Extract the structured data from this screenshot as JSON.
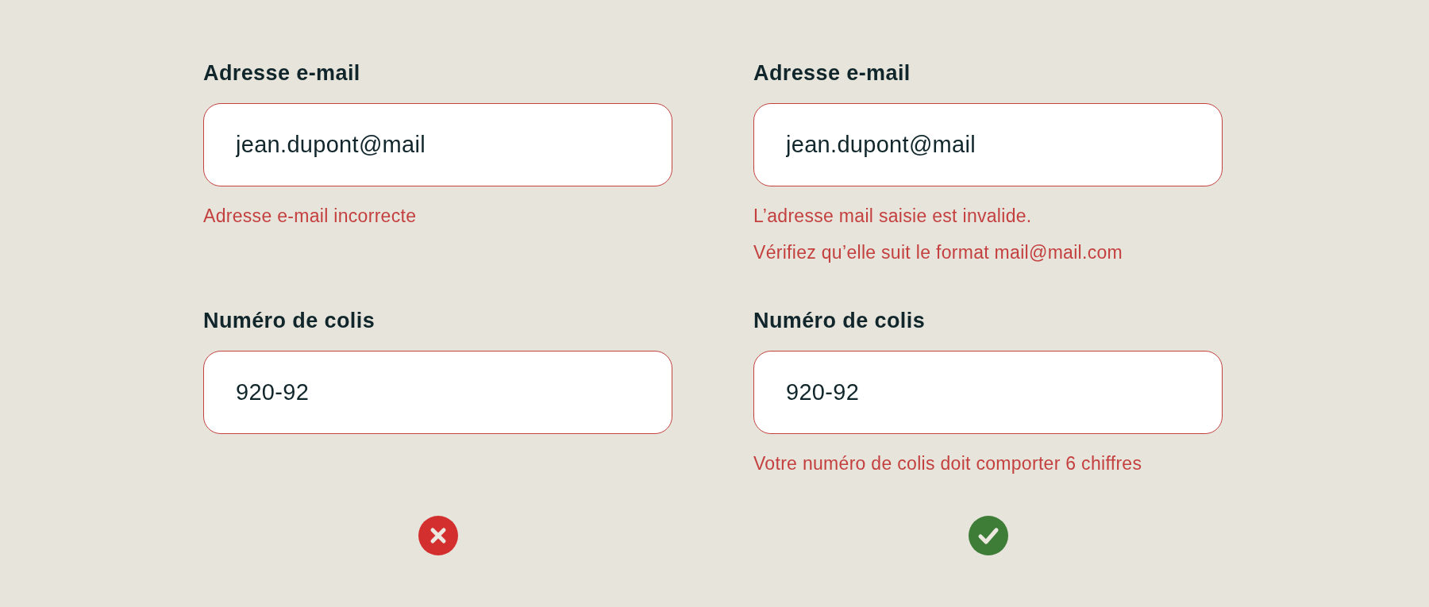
{
  "examples": [
    {
      "fields": [
        {
          "label": "Adresse e-mail",
          "value": "jean.dupont@mail",
          "invalid": true,
          "errors": [
            "Adresse e-mail incorrecte"
          ]
        },
        {
          "label": "Numéro de colis",
          "value": "920-92",
          "invalid": true
        }
      ],
      "verdict": {
        "kind": "wrong"
      }
    },
    {
      "fields": [
        {
          "label": "Adresse e-mail",
          "value": "jean.dupont@mail",
          "invalid": true,
          "errors": [
            "L’adresse mail saisie est invalide.",
            "Vérifiez qu’elle suit le format mail@mail.com"
          ]
        },
        {
          "label": "Numéro de colis",
          "value": "920-92",
          "invalid": true,
          "errors": [
            "Votre numéro de colis doit comporter 6 chiffres"
          ]
        }
      ],
      "verdict": {
        "kind": "right"
      }
    }
  ]
}
